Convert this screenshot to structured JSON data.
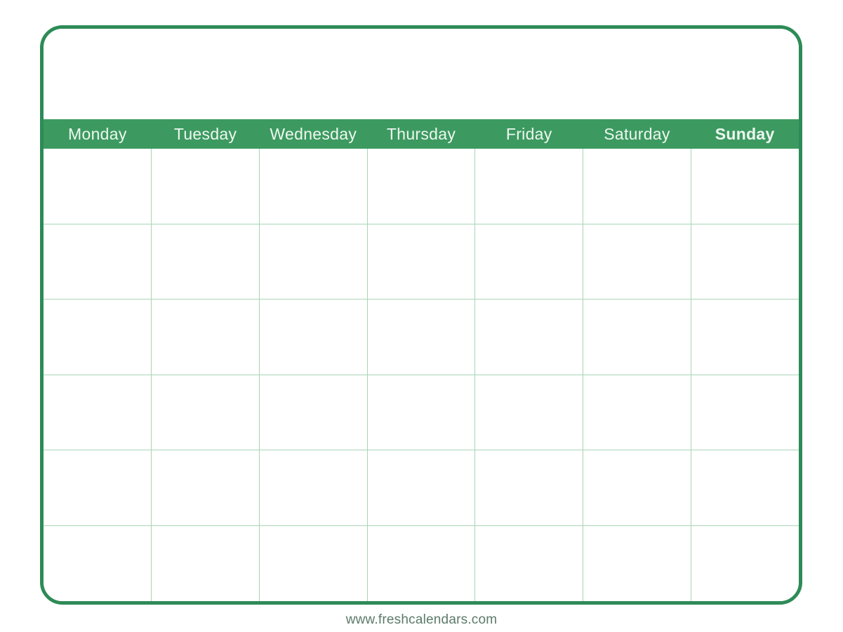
{
  "document": {
    "type": "blank-monthly-calendar-template",
    "title_area_text": ""
  },
  "theme": {
    "border_green": "#2e8b57",
    "header_band_green": "#3c9a60",
    "grid_line_green": "#a8d5b5",
    "header_text": "#eef7f0",
    "footer_text": "#5c7a68",
    "page_background": "#ffffff"
  },
  "weekdays": [
    {
      "label": "Monday",
      "bold": false
    },
    {
      "label": "Tuesday",
      "bold": false
    },
    {
      "label": "Wednesday",
      "bold": false
    },
    {
      "label": "Thursday",
      "bold": false
    },
    {
      "label": "Friday",
      "bold": false
    },
    {
      "label": "Saturday",
      "bold": false
    },
    {
      "label": "Sunday",
      "bold": true
    }
  ],
  "grid": {
    "rows": 6,
    "columns": 7,
    "cells": [
      [
        "",
        "",
        "",
        "",
        "",
        "",
        ""
      ],
      [
        "",
        "",
        "",
        "",
        "",
        "",
        ""
      ],
      [
        "",
        "",
        "",
        "",
        "",
        "",
        ""
      ],
      [
        "",
        "",
        "",
        "",
        "",
        "",
        ""
      ],
      [
        "",
        "",
        "",
        "",
        "",
        "",
        ""
      ],
      [
        "",
        "",
        "",
        "",
        "",
        "",
        ""
      ]
    ]
  },
  "footer": {
    "website": "www.freshcalendars.com"
  }
}
